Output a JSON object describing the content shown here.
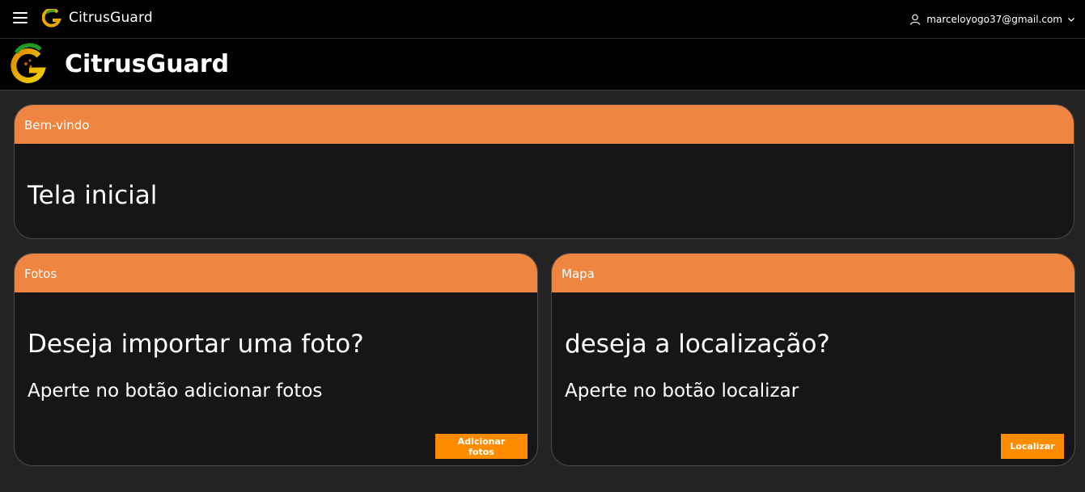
{
  "topbar": {
    "app_name": "CitrusGuard",
    "user_email": "marceloyogo37@gmail.com"
  },
  "brandbar": {
    "title": "CitrusGuard"
  },
  "welcome_card": {
    "header": "Bem-vindo",
    "title": "Tela inicial"
  },
  "photos_card": {
    "header": "Fotos",
    "title": "Deseja importar uma foto?",
    "text": "Aperte no botão adicionar fotos",
    "button_label": "Adicionar fotos"
  },
  "map_card": {
    "header": "Mapa",
    "title": "deseja a localização?",
    "text": "Aperte no botão localizar",
    "button_label": "Localizar"
  },
  "colors": {
    "accent": "#ee8540",
    "button": "#ff8c00",
    "background": "#232323",
    "card_background": "#161616"
  },
  "icons": [
    "hamburger-icon",
    "citrusguard-logo",
    "user-icon",
    "chevron-down-icon"
  ]
}
